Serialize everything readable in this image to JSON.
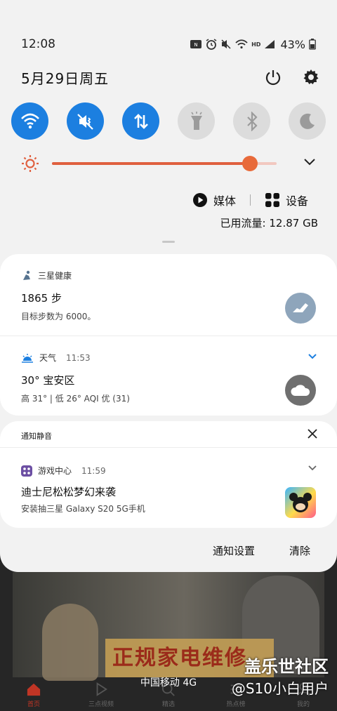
{
  "status_bar": {
    "time": "12:08",
    "battery_percent": "43%",
    "icons": [
      "nfc-icon",
      "alarm-icon",
      "vibrate-icon",
      "wifi-icon",
      "hd-icon",
      "signal-4g-icon",
      "battery-icon"
    ],
    "hd_label": "HD",
    "network_label": "4G"
  },
  "header": {
    "date": "5月29日周五",
    "power_icon": "power-icon",
    "settings_icon": "gear-icon"
  },
  "quick_toggles": [
    {
      "name": "wifi",
      "icon": "wifi-icon",
      "on": true
    },
    {
      "name": "sound",
      "icon": "vibrate-icon",
      "on": true
    },
    {
      "name": "mobile-data",
      "icon": "data-arrows-icon",
      "on": true
    },
    {
      "name": "flashlight",
      "icon": "flashlight-icon",
      "on": false
    },
    {
      "name": "bluetooth",
      "icon": "bluetooth-icon",
      "on": false
    },
    {
      "name": "night-mode",
      "icon": "moon-icon",
      "on": false
    }
  ],
  "brightness": {
    "level": 0.88
  },
  "media_row": {
    "media_label": "媒体",
    "devices_label": "设备"
  },
  "data_usage": "已用流量: 12.87 GB",
  "notifications": {
    "health": {
      "app": "三星健康",
      "title": "1865 步",
      "body": "目标步数为 6000。"
    },
    "weather": {
      "app": "天气",
      "time": "11:53",
      "title": "30° 宝安区",
      "body": "高 31° | 低 26° AQI 优 (31)"
    }
  },
  "silent_group": {
    "title": "通知静音",
    "game": {
      "app": "游戏中心",
      "time": "11:59",
      "title": "迪士尼松松梦幻来袭",
      "body": "安装抽三星 Galaxy S20 5G手机"
    }
  },
  "shade_actions": {
    "settings": "通知设置",
    "clear": "清除"
  },
  "background": {
    "banner_text": "正规家电维修",
    "carrier": "中国移动 4G",
    "watermark_title": "盖乐世社区",
    "watermark_user": "@S10小白用户",
    "nav": [
      "首页",
      "三点视频",
      "精选",
      "热点榜",
      "我的"
    ],
    "accent": "#c03525"
  },
  "colors": {
    "toggle_on": "#1c7fe0",
    "toggle_off": "#dcdcdc",
    "slider": "#e0603f",
    "shade_bg": "#f2f2f2"
  }
}
